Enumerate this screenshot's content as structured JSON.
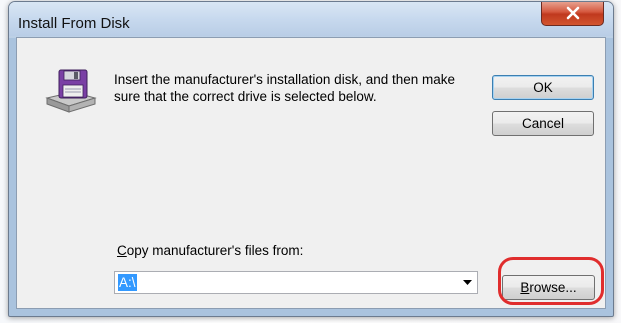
{
  "window": {
    "title": "Install From Disk",
    "close_symbol": "X"
  },
  "dialog": {
    "message": "Insert the manufacturer's installation disk, and then make sure that the correct drive is selected below.",
    "ok_label": "OK",
    "cancel_label": "Cancel",
    "copy_label_prefix": "C",
    "copy_label_rest": "opy manufacturer's files from:",
    "path_value": "A:\\",
    "browse_label_prefix": "B",
    "browse_label_rest": "rowse..."
  },
  "icons": {
    "disk": "floppy-disk-drive-icon",
    "dropdown": "chevron-down-icon",
    "close": "close-icon"
  },
  "colors": {
    "highlight": "#e02d2d",
    "selection": "#3399ff",
    "close_button": "#c0391e"
  }
}
